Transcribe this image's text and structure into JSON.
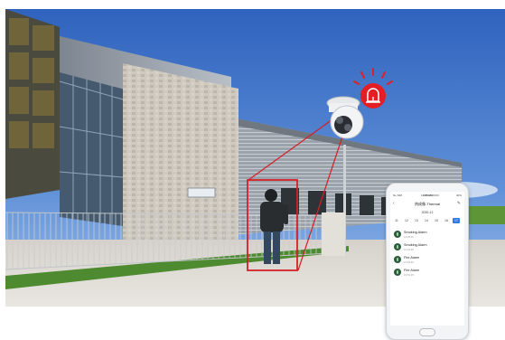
{
  "phone": {
    "status_left": "No SIM",
    "status_time": "11:25 AM",
    "status_right": "40%",
    "back": "‹",
    "title": "热成像-Thermal",
    "edit": "✎",
    "month": "2020-12",
    "days": [
      {
        "label": "11",
        "selected": false
      },
      {
        "label": "12",
        "selected": false
      },
      {
        "label": "13",
        "selected": false
      },
      {
        "label": "14",
        "selected": false
      },
      {
        "label": "15",
        "selected": false
      },
      {
        "label": "16",
        "selected": false
      },
      {
        "label": "17",
        "selected": true
      }
    ],
    "alarms": [
      {
        "name": "Smoking Alarm",
        "time": "14:28:45"
      },
      {
        "name": "Smoking Alarm",
        "time": "14:23:45"
      },
      {
        "name": "Fire Alarm",
        "time": "13:54:45"
      },
      {
        "name": "Fire Alarm",
        "time": "13:51:45"
      }
    ]
  },
  "colors": {
    "sky": "#3a6fc4",
    "detection_box": "#d51f26",
    "siren": "#e51e25",
    "building_stone": "#c9c4bb",
    "glass": "#4b5f73",
    "grass": "#4e8a2f"
  },
  "icons": [
    "siren-icon",
    "thermal-camera-icon",
    "person-detection-box"
  ]
}
